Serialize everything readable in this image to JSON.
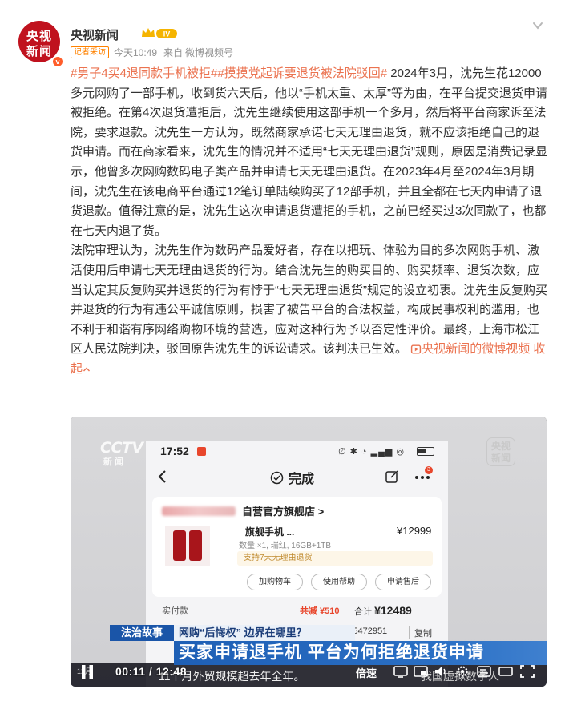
{
  "header": {
    "avatar_line1": "央视",
    "avatar_line2": "新闻",
    "verify_mark": "v",
    "username": "央视新闻",
    "level_badge": "IV",
    "tag": "记者采访",
    "time": "今天10:49",
    "source_prefix": "来自",
    "source": "微博视频号"
  },
  "post": {
    "topic1": "#男子4买4退同款手机被拒#",
    "topic2": "#摸摸党起诉要退货被法院驳回#",
    "para1": " 2024年3月，沈先生花12000多元网购了一部手机，收到货六天后，他以“手机太重、太厚”等为由，在平台提交退货申请被拒绝。在第4次退货遭拒后，沈先生继续使用这部手机一个多月，然后将平台商家诉至法院，要求退款。沈先生一方认为，既然商家承诺七天无理由退货，就不应该拒绝自己的退货申请。而在商家看来，沈先生的情况并不适用“七天无理由退货”规则，原因是消费记录显示，他曾多次网购数码电子类产品并申请七天无理由退货。在2023年4月至2024年3月期间，沈先生在该电商平台通过12笔订单陆续购买了12部手机，并且全都在七天内申请了退货退款。值得注意的是，沈先生这次申请退货遭拒的手机，之前已经买过3次同款了，也都在七天内退了货。",
    "para2": "法院审理认为，沈先生作为数码产品爱好者，存在以把玩、体验为目的多次网购手机、激活使用后申请七天无理由退货的行为。结合沈先生的购买目的、购买频率、退货次数，应当认定其反复购买并退货的行为有悖于“七天无理由退货”规定的设立初衷。沈先生反复购买并退货的行为有违公平诚信原则，损害了被告平台的合法权益，构成民事权利的滥用，也不利于和谐有序网络购物环境的营造，应对这种行为予以否定性评价。最终，上海市松江区人民法院判决，驳回原告沈先生的诉讼请求。该判决已生效。",
    "video_link": "央视新闻的微博视频",
    "collapse": "收起"
  },
  "video": {
    "cctv_line1": "CCTV 13",
    "cctv_line2": "新闻",
    "watermark": "央视新闻",
    "phone": {
      "clock": "17:52",
      "nav_title": "完成",
      "badge_count": "3",
      "shop_name": "自营官方旗舰店 >",
      "product_name": "旗舰手机 ...",
      "product_price": "¥12999",
      "product_spec": "数量 ×1, 瑞红, 16GB+1TB",
      "promo": "支持7天无理由退货",
      "btn_cart": "加购物车",
      "btn_help": "使用帮助",
      "btn_aftersale": "申请售后",
      "paid_label": "实付款",
      "discount": "共减 ¥510",
      "total_label": "合计 ",
      "total_value": "¥12489",
      "order_no": "1065472951",
      "copy": "复制"
    },
    "lower_third": {
      "category": "法治故事",
      "subtitle": "网购“后悔权” 边界在哪里？",
      "headline": "买家申请退手机 平台为何拒绝退货申请",
      "crawl": "11个月外贸规模超去年全年。",
      "crawl_right": "我国虚拟数字人",
      "crawl_date": "12月"
    },
    "controls": {
      "timecode": "00:11 / 12:48",
      "speed": "倍速"
    }
  },
  "colors": {
    "topic": "#eb7350",
    "brand_red": "#c0121e",
    "cctv_blue": "#1e5fb5"
  }
}
